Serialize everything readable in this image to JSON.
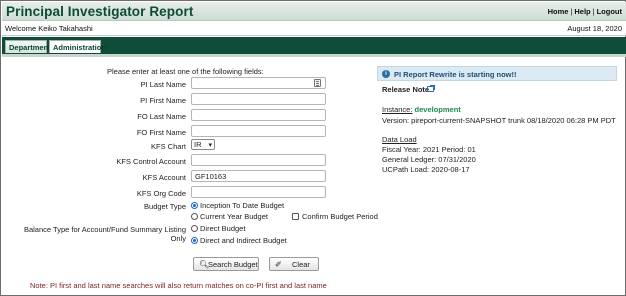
{
  "header": {
    "title": "Principal Investigator Report",
    "links": [
      "Home",
      "Help",
      "Logout"
    ],
    "link_separator": "|"
  },
  "welcome": {
    "text": "Welcome Keiko Takahashi",
    "date": "August 18, 2020"
  },
  "tabs": [
    {
      "label": "Department"
    },
    {
      "label": "Administration"
    }
  ],
  "form": {
    "instructions": "Please enter at least one of the following fields:",
    "fields": {
      "pi_last_name": {
        "label": "PI Last Name",
        "value": ""
      },
      "pi_first_name": {
        "label": "PI First Name",
        "value": ""
      },
      "fo_last_name": {
        "label": "FO Last Name",
        "value": ""
      },
      "fo_first_name": {
        "label": "FO First Name",
        "value": ""
      },
      "kfs_chart": {
        "label": "KFS Chart",
        "value": "IR"
      },
      "kfs_control_account": {
        "label": "KFS Control Account",
        "value": ""
      },
      "kfs_account": {
        "label": "KFS Account",
        "value": "GF10163"
      },
      "kfs_org_code": {
        "label": "KFS Org Code",
        "value": ""
      }
    },
    "budget_type": {
      "label": "Budget Type",
      "options": [
        {
          "label": "Inception To Date Budget",
          "selected": true
        },
        {
          "label": "Current Year Budget",
          "selected": false
        }
      ],
      "confirm_budget_period": {
        "label": "Confirm Budget Period",
        "checked": false
      }
    },
    "balance_type": {
      "label": "Balance Type for Account/Fund Summary Listing Only",
      "options": [
        {
          "label": "Direct Budget",
          "selected": false
        },
        {
          "label": "Direct and Indirect Budget",
          "selected": true
        }
      ]
    },
    "buttons": {
      "search": "Search Budget",
      "clear": "Clear"
    },
    "note": "Note: PI first and last name searches will also return matches on co-PI first and last name"
  },
  "sidebar": {
    "banner": "PI Report Rewrite is starting now!!",
    "release_note": "Release Note",
    "instance_label": "Instance:",
    "instance_value": "development",
    "version": "Version: pireport-current-SNAPSHOT trunk 08/18/2020 06:28 PM PDT",
    "data_load_heading": "Data Load",
    "fiscal": "Fiscal Year: 2021 Period: 01",
    "general_ledger": "General Ledger: 07/31/2020",
    "ucpath": "UCPath Load: 2020-08-17"
  },
  "colors": {
    "header_green": "#0c4b38",
    "tabbar": "#0f4d3a",
    "banner_bg": "#dbe9f3",
    "instance_green": "#1e8a4f",
    "note_red": "#7a1f1f"
  }
}
